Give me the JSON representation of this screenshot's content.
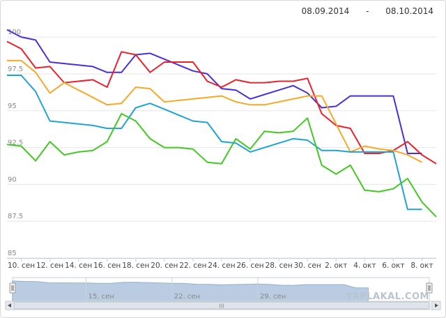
{
  "header": {
    "date_from": "08.09.2014",
    "date_sep": "-",
    "date_to": "08.10.2014"
  },
  "navigator": {
    "labels": [
      "15. сен",
      "22. сен",
      "29. сен"
    ],
    "scroll_label": "III"
  },
  "watermark": "YAPLAKAL.COM",
  "chart_data": {
    "type": "line",
    "title": "",
    "xlabel": "",
    "ylabel": "",
    "ylim": [
      85,
      101
    ],
    "yticks": [
      85,
      87.5,
      90,
      92.5,
      95,
      97.5,
      100
    ],
    "ytick_labels": [
      "85",
      "87.5",
      "90",
      "92.5",
      "95",
      "97.5",
      "100"
    ],
    "grid": true,
    "x": [
      "09.09",
      "10.09",
      "11.09",
      "12.09",
      "13.09",
      "14.09",
      "15.09",
      "16.09",
      "17.09",
      "18.09",
      "19.09",
      "20.09",
      "21.09",
      "22.09",
      "23.09",
      "24.09",
      "25.09",
      "26.09",
      "27.09",
      "28.09",
      "29.09",
      "30.09",
      "01.10",
      "02.10",
      "03.10",
      "04.10",
      "05.10",
      "06.10",
      "07.10",
      "08.10",
      "09.10"
    ],
    "xtick_labels": [
      "10. сен",
      "12. сен",
      "14. сен",
      "16. сен",
      "18. сен",
      "20. сен",
      "22. сен",
      "24. сен",
      "26. сен",
      "28. сен",
      "30. сен",
      "2. окт",
      "4. окт",
      "6. окт",
      "8. окт"
    ],
    "series": [
      {
        "color": "#4b2fd6",
        "values": [
          100.5,
          100.0,
          99.8,
          98.3,
          98.2,
          98.1,
          98.0,
          97.6,
          97.6,
          98.8,
          98.9,
          98.5,
          98.1,
          97.7,
          97.5,
          96.5,
          96.4,
          95.8,
          96.1,
          96.4,
          96.7,
          96.2,
          95.2,
          95.3,
          96.0,
          96.0,
          96.0,
          96.0,
          92.1,
          92.1,
          null
        ]
      },
      {
        "color": "#e8212b",
        "values": [
          99.7,
          99.2,
          97.9,
          98.0,
          96.9,
          97.0,
          97.1,
          96.6,
          99.0,
          98.8,
          97.6,
          98.3,
          98.3,
          98.3,
          97.0,
          96.6,
          97.1,
          96.9,
          96.9,
          97.0,
          97.0,
          97.2,
          94.8,
          94.0,
          93.8,
          92.1,
          92.1,
          92.3,
          92.9,
          92.0,
          91.4
        ]
      },
      {
        "color": "#f7a828",
        "values": [
          98.4,
          98.4,
          97.6,
          96.2,
          96.9,
          96.4,
          95.9,
          95.4,
          95.5,
          96.6,
          96.5,
          95.6,
          95.7,
          95.8,
          95.9,
          96.0,
          95.6,
          95.4,
          95.4,
          95.6,
          95.8,
          96.0,
          96.0,
          94.1,
          92.2,
          92.6,
          92.4,
          92.3,
          92.0,
          91.5,
          null
        ]
      },
      {
        "color": "#1fa3d1",
        "values": [
          97.4,
          97.4,
          96.3,
          94.3,
          94.2,
          94.1,
          94.0,
          93.8,
          93.8,
          95.2,
          95.5,
          95.1,
          94.7,
          94.3,
          94.2,
          92.9,
          92.8,
          92.2,
          92.5,
          92.8,
          93.1,
          93.0,
          92.3,
          92.3,
          92.2,
          92.2,
          92.2,
          92.2,
          88.3,
          88.3,
          null
        ]
      },
      {
        "color": "#43c723",
        "values": [
          92.7,
          92.6,
          91.6,
          92.9,
          92.0,
          92.2,
          92.3,
          92.9,
          94.8,
          94.3,
          93.1,
          92.5,
          92.5,
          92.4,
          91.5,
          91.4,
          93.1,
          92.4,
          93.6,
          93.5,
          93.6,
          94.5,
          91.3,
          90.7,
          91.3,
          89.6,
          89.5,
          89.7,
          90.4,
          88.8,
          87.8
        ]
      }
    ]
  }
}
